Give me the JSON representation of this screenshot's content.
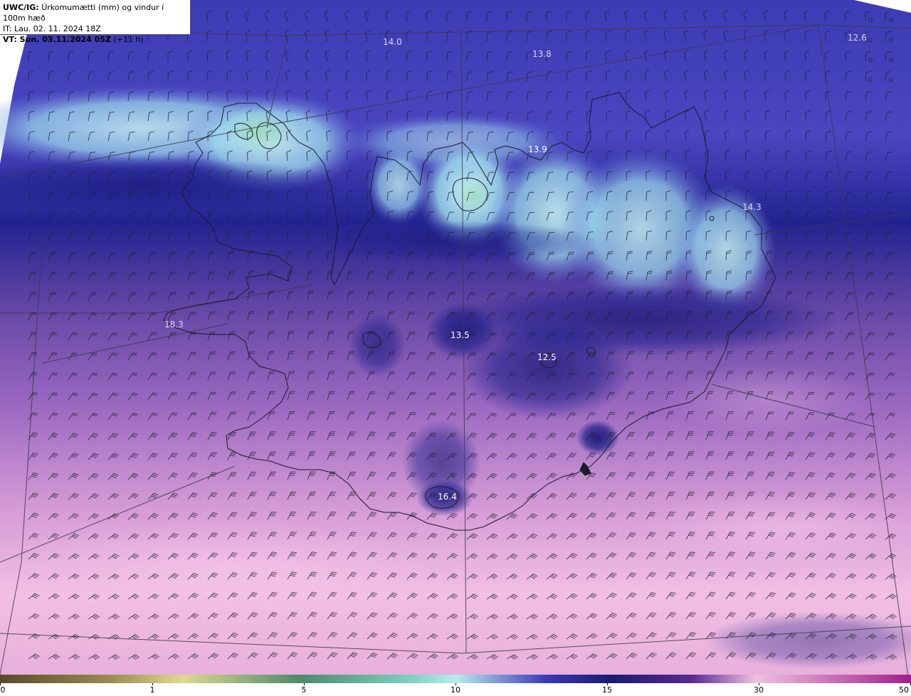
{
  "header": {
    "model_label": "UWC/IG:",
    "title": "Úrkomumætti (mm) og vindur í 100m hæð",
    "it_line": "IT: Lau. 02. 11. 2024 18Z",
    "vt_label": "VT: Sun. 03.11.2024 05Z",
    "vt_offset": "(+11 h)"
  },
  "map_labels": [
    {
      "text": "14.0",
      "name": "label-14-0-northwest"
    },
    {
      "text": "13.8",
      "name": "label-13-8-north"
    },
    {
      "text": "12.6",
      "name": "label-12-6-northeast"
    },
    {
      "text": "13.9",
      "name": "label-13-9-north-coast"
    },
    {
      "text": "14.3",
      "name": "label-14-3-east"
    },
    {
      "text": "18.3",
      "name": "label-18-3-west"
    },
    {
      "text": "13.5",
      "name": "label-13-5-central"
    },
    {
      "text": "12.5",
      "name": "label-12-5-central-east"
    },
    {
      "text": "16.4",
      "name": "label-16-4-south"
    }
  ],
  "colorbar": {
    "ticks": [
      "0",
      "1",
      "5",
      "10",
      "15",
      "30",
      "50"
    ],
    "colors": [
      "#5a4a2a",
      "#9a8a50",
      "#e0d890",
      "#4c8a6a",
      "#b8ecec",
      "#1e2a9a",
      "#1a1a70",
      "#d07ab8",
      "#f0c0e0",
      "#a0208a"
    ]
  },
  "map_colors": {
    "precip_light": "#b0ecf0",
    "precip_mid": "#2d2fa0",
    "precip_heavy": "#1c1c7a",
    "low_violet": "#8050b0",
    "pink": "#f0b6df",
    "coast": "#1a1a2a",
    "grid": "#3a3a4a",
    "barb": "#222233"
  }
}
